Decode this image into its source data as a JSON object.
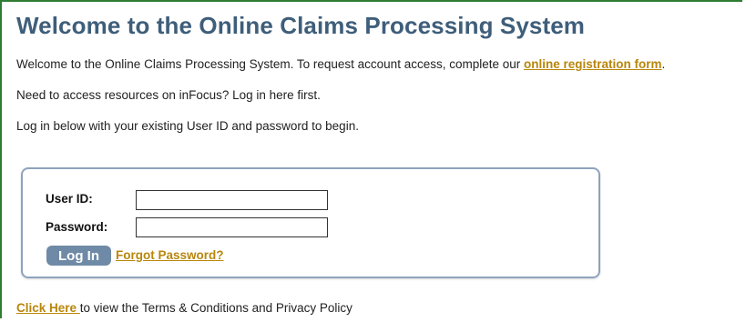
{
  "page": {
    "title": "Welcome to the Online Claims Processing System",
    "intro": {
      "text": "Welcome to the Online Claims Processing System. To request account access, complete our ",
      "link": "online registration form",
      "suffix": "."
    },
    "infocus_note": "Need to access resources on inFocus? Log in here first.",
    "instructions": "Log in below with your existing User ID and password to begin."
  },
  "login": {
    "user_label": "User ID:",
    "user_value": "",
    "password_label": "Password:",
    "password_value": "",
    "button_label": "Log In",
    "forgot_link": "Forgot Password?"
  },
  "footer": {
    "link": "Click Here ",
    "text": "to view the Terms & Conditions and Privacy Policy"
  },
  "colors": {
    "title": "#3e5e7a",
    "link": "#b8860b",
    "button": "#6f8aa6",
    "box_border": "#8fa3bd",
    "frame_border": "#2e7d32"
  }
}
